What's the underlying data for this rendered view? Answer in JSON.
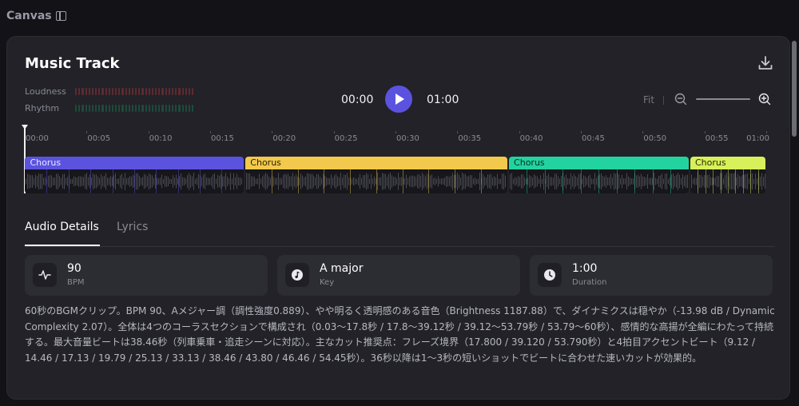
{
  "app": {
    "title": "Canvas",
    "panel_icon": "sidebar-icon"
  },
  "track": {
    "title": "Music Track",
    "download_icon": "download-icon"
  },
  "meters": [
    {
      "label": "Loudness",
      "color": "#5e2a30"
    },
    {
      "label": "Rhythm",
      "color": "#1f4a3a"
    }
  ],
  "transport": {
    "current_time": "00:00",
    "total_time": "01:00",
    "play_icon": "play-icon",
    "accent": "#5b53df"
  },
  "zoom": {
    "fit_label": "Fit",
    "zoom_out_icon": "zoom-out-icon",
    "zoom_in_icon": "zoom-in-icon"
  },
  "timeline": {
    "duration_seconds": 60,
    "ticks": [
      "00:00",
      "00:05",
      "00:10",
      "00:15",
      "00:20",
      "00:25",
      "00:30",
      "00:35",
      "00:40",
      "00:45",
      "00:50",
      "00:55",
      "01:00"
    ],
    "sections": [
      {
        "label": "Chorus",
        "start": 0.03,
        "end": 17.8,
        "color": "#5b53e0",
        "text_color": "#e8e8ff"
      },
      {
        "label": "Chorus",
        "start": 17.8,
        "end": 39.12,
        "color": "#f2c94c",
        "text_color": "#2a2208"
      },
      {
        "label": "Chorus",
        "start": 39.12,
        "end": 53.79,
        "color": "#22d3a0",
        "text_color": "#0b2a22"
      },
      {
        "label": "Chorus",
        "start": 53.79,
        "end": 60,
        "color": "#d8f05a",
        "text_color": "#262a08"
      }
    ]
  },
  "tabs": [
    {
      "label": "Audio Details",
      "active": true
    },
    {
      "label": "Lyrics",
      "active": false
    }
  ],
  "stats": [
    {
      "value": "90",
      "label": "BPM",
      "icon": "pulse-icon"
    },
    {
      "value": "A major",
      "label": "Key",
      "icon": "music-note-icon"
    },
    {
      "value": "1:00",
      "label": "Duration",
      "icon": "clock-icon"
    }
  ],
  "description": "60秒のBGMクリップ。BPM 90、Aメジャー調（調性強度0.889）、やや明るく透明感のある音色（Brightness 1187.88）で、ダイナミクスは穏やか（-13.98 dB / Dynamic Complexity 2.07）。全体は4つのコーラスセクションで構成され（0.03〜17.8秒 / 17.8〜39.12秒 / 39.12〜53.79秒 / 53.79〜60秒）、感情的な高揚が全編にわたって持続する。最大音量ビートは38.46秒（列車乗車・追走シーンに対応）。主なカット推奨点：フレーズ境界（17.800 / 39.120 / 53.790秒）と4拍目アクセントビート（9.12 / 14.46 / 17.13 / 19.79 / 25.13 / 33.13 / 38.46 / 43.80 / 46.46 / 54.45秒）。36秒以降は1〜3秒の短いショットでビートに合わせた速いカットが効果的。"
}
